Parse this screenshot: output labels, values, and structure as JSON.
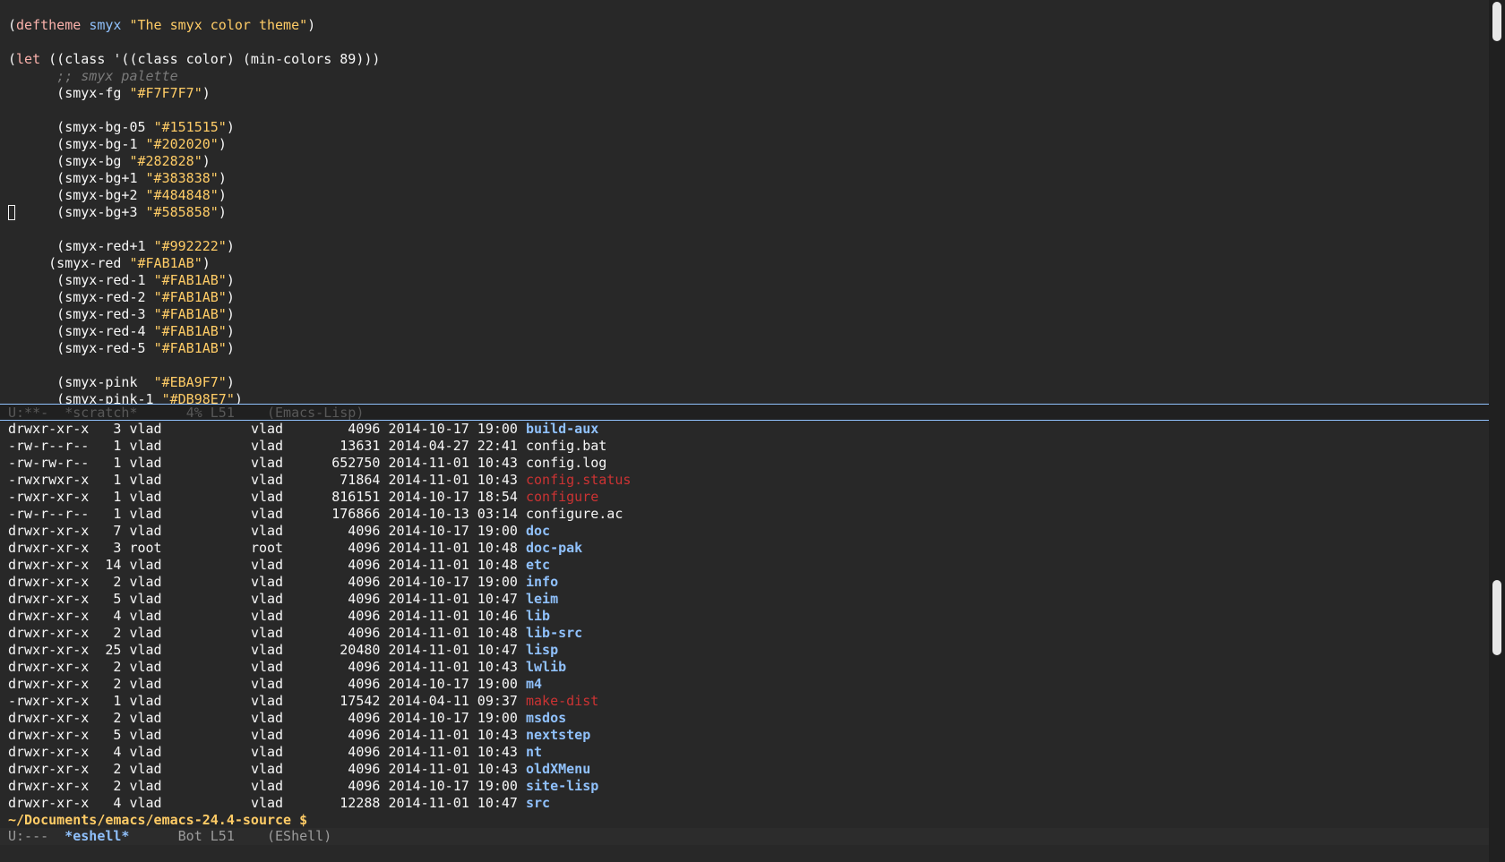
{
  "theme": {
    "background": "#282828",
    "foreground": "#F7F7F7",
    "keyword": "#FAB1AB",
    "function": "#90C1FC",
    "string": "#FFCC66",
    "comment": "#7A7A7A",
    "directory": "#90C1FC",
    "executable": "#CC3333"
  },
  "code_buffer": {
    "lines": [
      [
        {
          "t": "(",
          "c": ""
        },
        {
          "t": "deftheme",
          "c": "kw"
        },
        {
          "t": " ",
          "c": ""
        },
        {
          "t": "smyx",
          "c": "fn"
        },
        {
          "t": " ",
          "c": ""
        },
        {
          "t": "\"The smyx color theme\"",
          "c": "str"
        },
        {
          "t": ")",
          "c": ""
        }
      ],
      [],
      [
        {
          "t": "(",
          "c": ""
        },
        {
          "t": "let",
          "c": "kw"
        },
        {
          "t": " ((class '((class color) (min-colors 89)))",
          "c": ""
        }
      ],
      [
        {
          "t": "      ",
          "c": ""
        },
        {
          "t": ";; smyx palette",
          "c": "cmt"
        }
      ],
      [
        {
          "t": "      (smyx-fg ",
          "c": ""
        },
        {
          "t": "\"#F7F7F7\"",
          "c": "str"
        },
        {
          "t": ")",
          "c": ""
        }
      ],
      [],
      [
        {
          "t": "      (smyx-bg-05 ",
          "c": ""
        },
        {
          "t": "\"#151515\"",
          "c": "str"
        },
        {
          "t": ")",
          "c": ""
        }
      ],
      [
        {
          "t": "      (smyx-bg-1 ",
          "c": ""
        },
        {
          "t": "\"#202020\"",
          "c": "str"
        },
        {
          "t": ")",
          "c": ""
        }
      ],
      [
        {
          "t": "      (smyx-bg ",
          "c": ""
        },
        {
          "t": "\"#282828\"",
          "c": "str"
        },
        {
          "t": ")",
          "c": ""
        }
      ],
      [
        {
          "t": "      (smyx-bg+1 ",
          "c": ""
        },
        {
          "t": "\"#383838\"",
          "c": "str"
        },
        {
          "t": ")",
          "c": ""
        }
      ],
      [
        {
          "t": "      (smyx-bg+2 ",
          "c": ""
        },
        {
          "t": "\"#484848\"",
          "c": "str"
        },
        {
          "t": ")",
          "c": ""
        }
      ],
      [
        {
          "t": "      (smyx-bg+3 ",
          "c": ""
        },
        {
          "t": "\"#585858\"",
          "c": "str"
        },
        {
          "t": ")",
          "c": ""
        }
      ],
      [],
      [
        {
          "t": "      (smyx-red+1 ",
          "c": ""
        },
        {
          "t": "\"#992222\"",
          "c": "str"
        },
        {
          "t": ")",
          "c": ""
        }
      ],
      [
        {
          "t": "     (smyx-red ",
          "c": ""
        },
        {
          "t": "\"#FAB1AB\"",
          "c": "str"
        },
        {
          "t": ")",
          "c": ""
        }
      ],
      [
        {
          "t": "      (smyx-red-1 ",
          "c": ""
        },
        {
          "t": "\"#FAB1AB\"",
          "c": "str"
        },
        {
          "t": ")",
          "c": ""
        }
      ],
      [
        {
          "t": "      (smyx-red-2 ",
          "c": ""
        },
        {
          "t": "\"#FAB1AB\"",
          "c": "str"
        },
        {
          "t": ")",
          "c": ""
        }
      ],
      [
        {
          "t": "      (smyx-red-3 ",
          "c": ""
        },
        {
          "t": "\"#FAB1AB\"",
          "c": "str"
        },
        {
          "t": ")",
          "c": ""
        }
      ],
      [
        {
          "t": "      (smyx-red-4 ",
          "c": ""
        },
        {
          "t": "\"#FAB1AB\"",
          "c": "str"
        },
        {
          "t": ")",
          "c": ""
        }
      ],
      [
        {
          "t": "      (smyx-red-5 ",
          "c": ""
        },
        {
          "t": "\"#FAB1AB\"",
          "c": "str"
        },
        {
          "t": ")",
          "c": ""
        }
      ],
      [],
      [
        {
          "t": "      (smyx-pink  ",
          "c": ""
        },
        {
          "t": "\"#EBA9F7\"",
          "c": "str"
        },
        {
          "t": ")",
          "c": ""
        }
      ],
      [
        {
          "t": "      (smyx-pink-1 ",
          "c": ""
        },
        {
          "t": "\"#DB98E7\"",
          "c": "str"
        },
        {
          "t": ")",
          "c": ""
        }
      ]
    ]
  },
  "top_modeline": {
    "status": "U:**-",
    "buffer_name": "*scratch*",
    "position": "4% L51",
    "mode": "(Emacs-Lisp)"
  },
  "dir_listing": {
    "entries": [
      {
        "perms": "drwxr-xr-x",
        "links": "3",
        "owner": "vlad",
        "group": "vlad",
        "size": "4096",
        "date": "2014-10-17 19:00",
        "name": "build-aux",
        "kind": "dir"
      },
      {
        "perms": "-rw-r--r--",
        "links": "1",
        "owner": "vlad",
        "group": "vlad",
        "size": "13631",
        "date": "2014-04-27 22:41",
        "name": "config.bat",
        "kind": "reg"
      },
      {
        "perms": "-rw-rw-r--",
        "links": "1",
        "owner": "vlad",
        "group": "vlad",
        "size": "652750",
        "date": "2014-11-01 10:43",
        "name": "config.log",
        "kind": "reg"
      },
      {
        "perms": "-rwxrwxr-x",
        "links": "1",
        "owner": "vlad",
        "group": "vlad",
        "size": "71864",
        "date": "2014-11-01 10:43",
        "name": "config.status",
        "kind": "exe"
      },
      {
        "perms": "-rwxr-xr-x",
        "links": "1",
        "owner": "vlad",
        "group": "vlad",
        "size": "816151",
        "date": "2014-10-17 18:54",
        "name": "configure",
        "kind": "exe"
      },
      {
        "perms": "-rw-r--r--",
        "links": "1",
        "owner": "vlad",
        "group": "vlad",
        "size": "176866",
        "date": "2014-10-13 03:14",
        "name": "configure.ac",
        "kind": "reg"
      },
      {
        "perms": "drwxr-xr-x",
        "links": "7",
        "owner": "vlad",
        "group": "vlad",
        "size": "4096",
        "date": "2014-10-17 19:00",
        "name": "doc",
        "kind": "dir"
      },
      {
        "perms": "drwxr-xr-x",
        "links": "3",
        "owner": "root",
        "group": "root",
        "size": "4096",
        "date": "2014-11-01 10:48",
        "name": "doc-pak",
        "kind": "dir"
      },
      {
        "perms": "drwxr-xr-x",
        "links": "14",
        "owner": "vlad",
        "group": "vlad",
        "size": "4096",
        "date": "2014-11-01 10:48",
        "name": "etc",
        "kind": "dir"
      },
      {
        "perms": "drwxr-xr-x",
        "links": "2",
        "owner": "vlad",
        "group": "vlad",
        "size": "4096",
        "date": "2014-10-17 19:00",
        "name": "info",
        "kind": "dir"
      },
      {
        "perms": "drwxr-xr-x",
        "links": "5",
        "owner": "vlad",
        "group": "vlad",
        "size": "4096",
        "date": "2014-11-01 10:47",
        "name": "leim",
        "kind": "dir"
      },
      {
        "perms": "drwxr-xr-x",
        "links": "4",
        "owner": "vlad",
        "group": "vlad",
        "size": "4096",
        "date": "2014-11-01 10:46",
        "name": "lib",
        "kind": "dir"
      },
      {
        "perms": "drwxr-xr-x",
        "links": "2",
        "owner": "vlad",
        "group": "vlad",
        "size": "4096",
        "date": "2014-11-01 10:48",
        "name": "lib-src",
        "kind": "dir"
      },
      {
        "perms": "drwxr-xr-x",
        "links": "25",
        "owner": "vlad",
        "group": "vlad",
        "size": "20480",
        "date": "2014-11-01 10:47",
        "name": "lisp",
        "kind": "dir"
      },
      {
        "perms": "drwxr-xr-x",
        "links": "2",
        "owner": "vlad",
        "group": "vlad",
        "size": "4096",
        "date": "2014-11-01 10:43",
        "name": "lwlib",
        "kind": "dir"
      },
      {
        "perms": "drwxr-xr-x",
        "links": "2",
        "owner": "vlad",
        "group": "vlad",
        "size": "4096",
        "date": "2014-10-17 19:00",
        "name": "m4",
        "kind": "dir"
      },
      {
        "perms": "-rwxr-xr-x",
        "links": "1",
        "owner": "vlad",
        "group": "vlad",
        "size": "17542",
        "date": "2014-04-11 09:37",
        "name": "make-dist",
        "kind": "exe"
      },
      {
        "perms": "drwxr-xr-x",
        "links": "2",
        "owner": "vlad",
        "group": "vlad",
        "size": "4096",
        "date": "2014-10-17 19:00",
        "name": "msdos",
        "kind": "dir"
      },
      {
        "perms": "drwxr-xr-x",
        "links": "5",
        "owner": "vlad",
        "group": "vlad",
        "size": "4096",
        "date": "2014-11-01 10:43",
        "name": "nextstep",
        "kind": "dir"
      },
      {
        "perms": "drwxr-xr-x",
        "links": "4",
        "owner": "vlad",
        "group": "vlad",
        "size": "4096",
        "date": "2014-11-01 10:43",
        "name": "nt",
        "kind": "dir"
      },
      {
        "perms": "drwxr-xr-x",
        "links": "2",
        "owner": "vlad",
        "group": "vlad",
        "size": "4096",
        "date": "2014-11-01 10:43",
        "name": "oldXMenu",
        "kind": "dir"
      },
      {
        "perms": "drwxr-xr-x",
        "links": "2",
        "owner": "vlad",
        "group": "vlad",
        "size": "4096",
        "date": "2014-10-17 19:00",
        "name": "site-lisp",
        "kind": "dir"
      },
      {
        "perms": "drwxr-xr-x",
        "links": "4",
        "owner": "vlad",
        "group": "vlad",
        "size": "12288",
        "date": "2014-11-01 10:47",
        "name": "src",
        "kind": "dir"
      }
    ]
  },
  "eshell": {
    "prompt": "~/Documents/emacs/emacs-24.4-source $"
  },
  "bottom_modeline": {
    "status": "U:---",
    "buffer_name": "*eshell*",
    "position": "Bot L51",
    "mode": "(EShell)"
  }
}
